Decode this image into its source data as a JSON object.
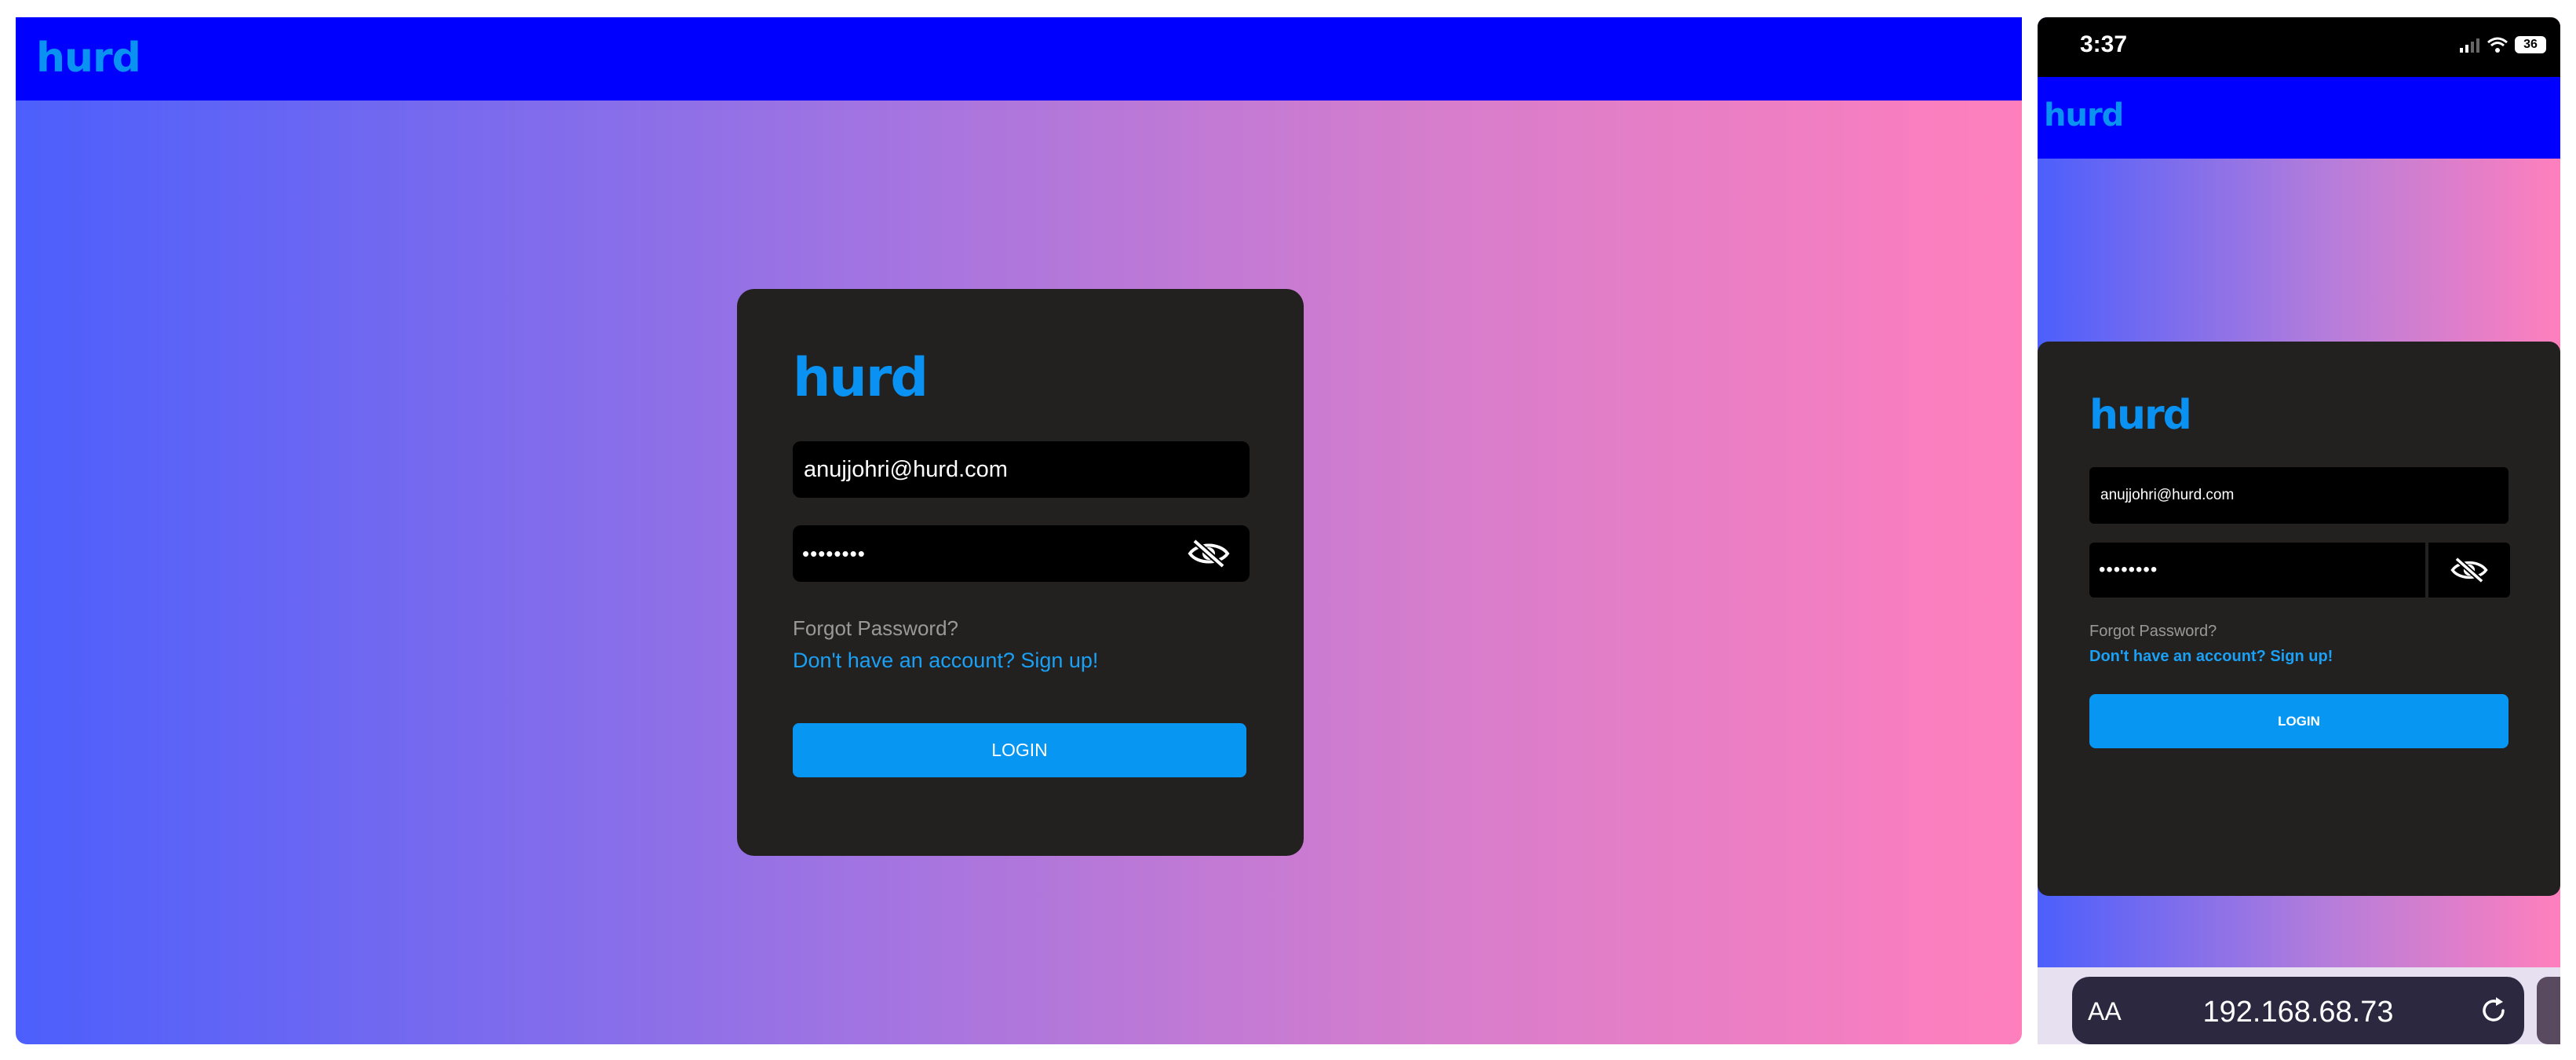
{
  "desktop": {
    "header": {
      "brand": "hurd"
    },
    "login_card": {
      "brand": "hurd",
      "email_value": "anujjohri@hurd.com",
      "password_value": "••••••••",
      "forgot_password": "Forgot Password?",
      "signup_link": "Don't have an account? Sign up!",
      "login_button": "LOGIN"
    }
  },
  "phone": {
    "status_bar": {
      "time": "3:37",
      "battery": "36"
    },
    "header": {
      "brand": "hurd"
    },
    "login_card": {
      "brand": "hurd",
      "email_value": "anujjohri@hurd.com",
      "password_value": "••••••••",
      "forgot_password": "Forgot Password?",
      "signup_link": "Don't have an account? Sign up!",
      "login_button": "LOGIN"
    },
    "browser": {
      "text_size_label": "AA",
      "url": "192.168.68.73"
    }
  },
  "colors": {
    "header_blue": "#0000ff",
    "brand_blue": "#0a92f2",
    "button_blue": "#0896f3",
    "card_bg": "#232020",
    "gradient_start": "#4c5ffc",
    "gradient_end": "#ff7fbd"
  },
  "icons": [
    "eye-off-icon",
    "signal-icon",
    "wifi-icon",
    "battery-icon",
    "reload-icon"
  ]
}
